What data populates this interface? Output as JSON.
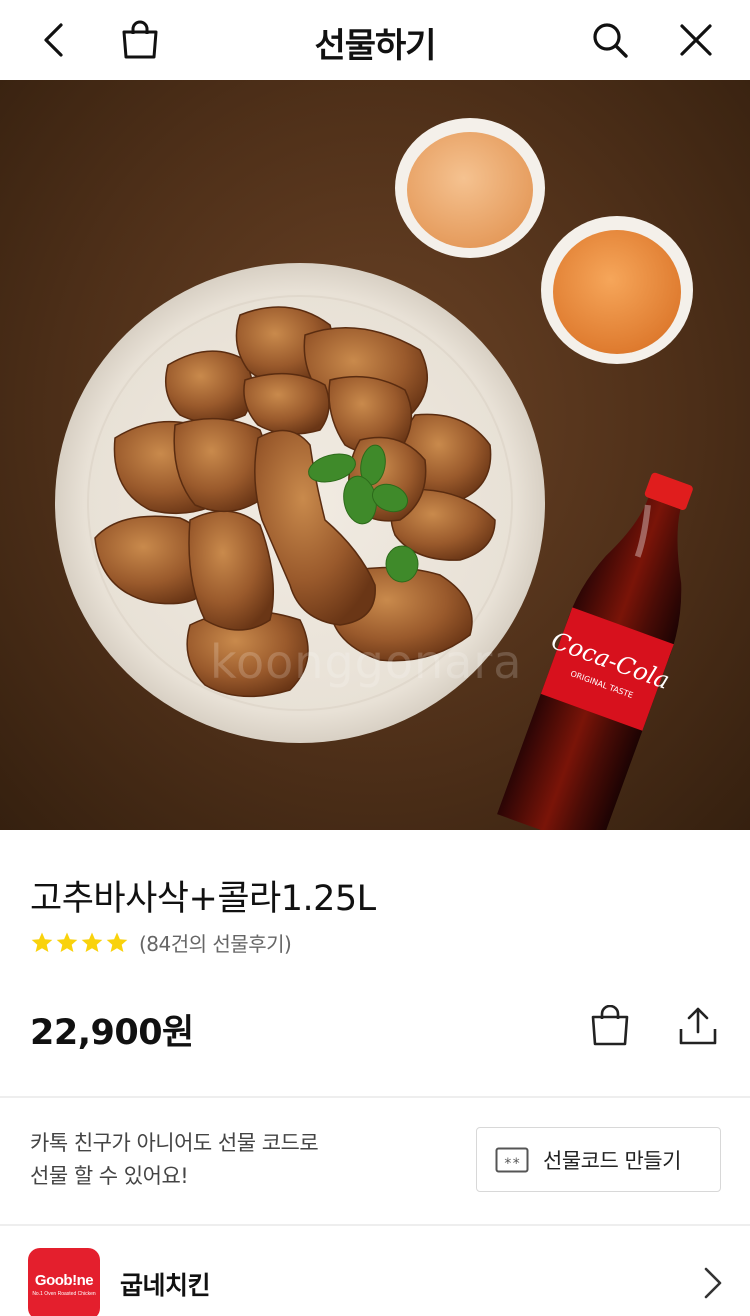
{
  "header": {
    "title": "선물하기",
    "back_icon": "chevron-left-icon",
    "bag_icon": "shopping-bag-icon",
    "search_icon": "search-icon",
    "close_icon": "close-icon"
  },
  "hero": {
    "watermark": "koonggonara",
    "bottle_brand": "Coca-Cola",
    "bottle_tagline": "ORIGINAL TASTE"
  },
  "product": {
    "name": "고추바사삭+콜라1.25L",
    "rating_stars": 4,
    "review_count": "(84건의 선물후기)",
    "price": "22,900원"
  },
  "promo": {
    "line1": "카톡 친구가 아니어도 선물 코드로",
    "line2": "선물 할 수 있어요!",
    "code_button_label": "선물코드 만들기",
    "code_button_icon_text": "**"
  },
  "brand": {
    "logo_text": "Goob!ne",
    "logo_subtext": "No.1 Oven Roasted Chicken",
    "name": "굽네치킨"
  },
  "colors": {
    "star": "#f9d20c",
    "brand_red": "#e41f2d",
    "divider": "#eeeeee"
  }
}
